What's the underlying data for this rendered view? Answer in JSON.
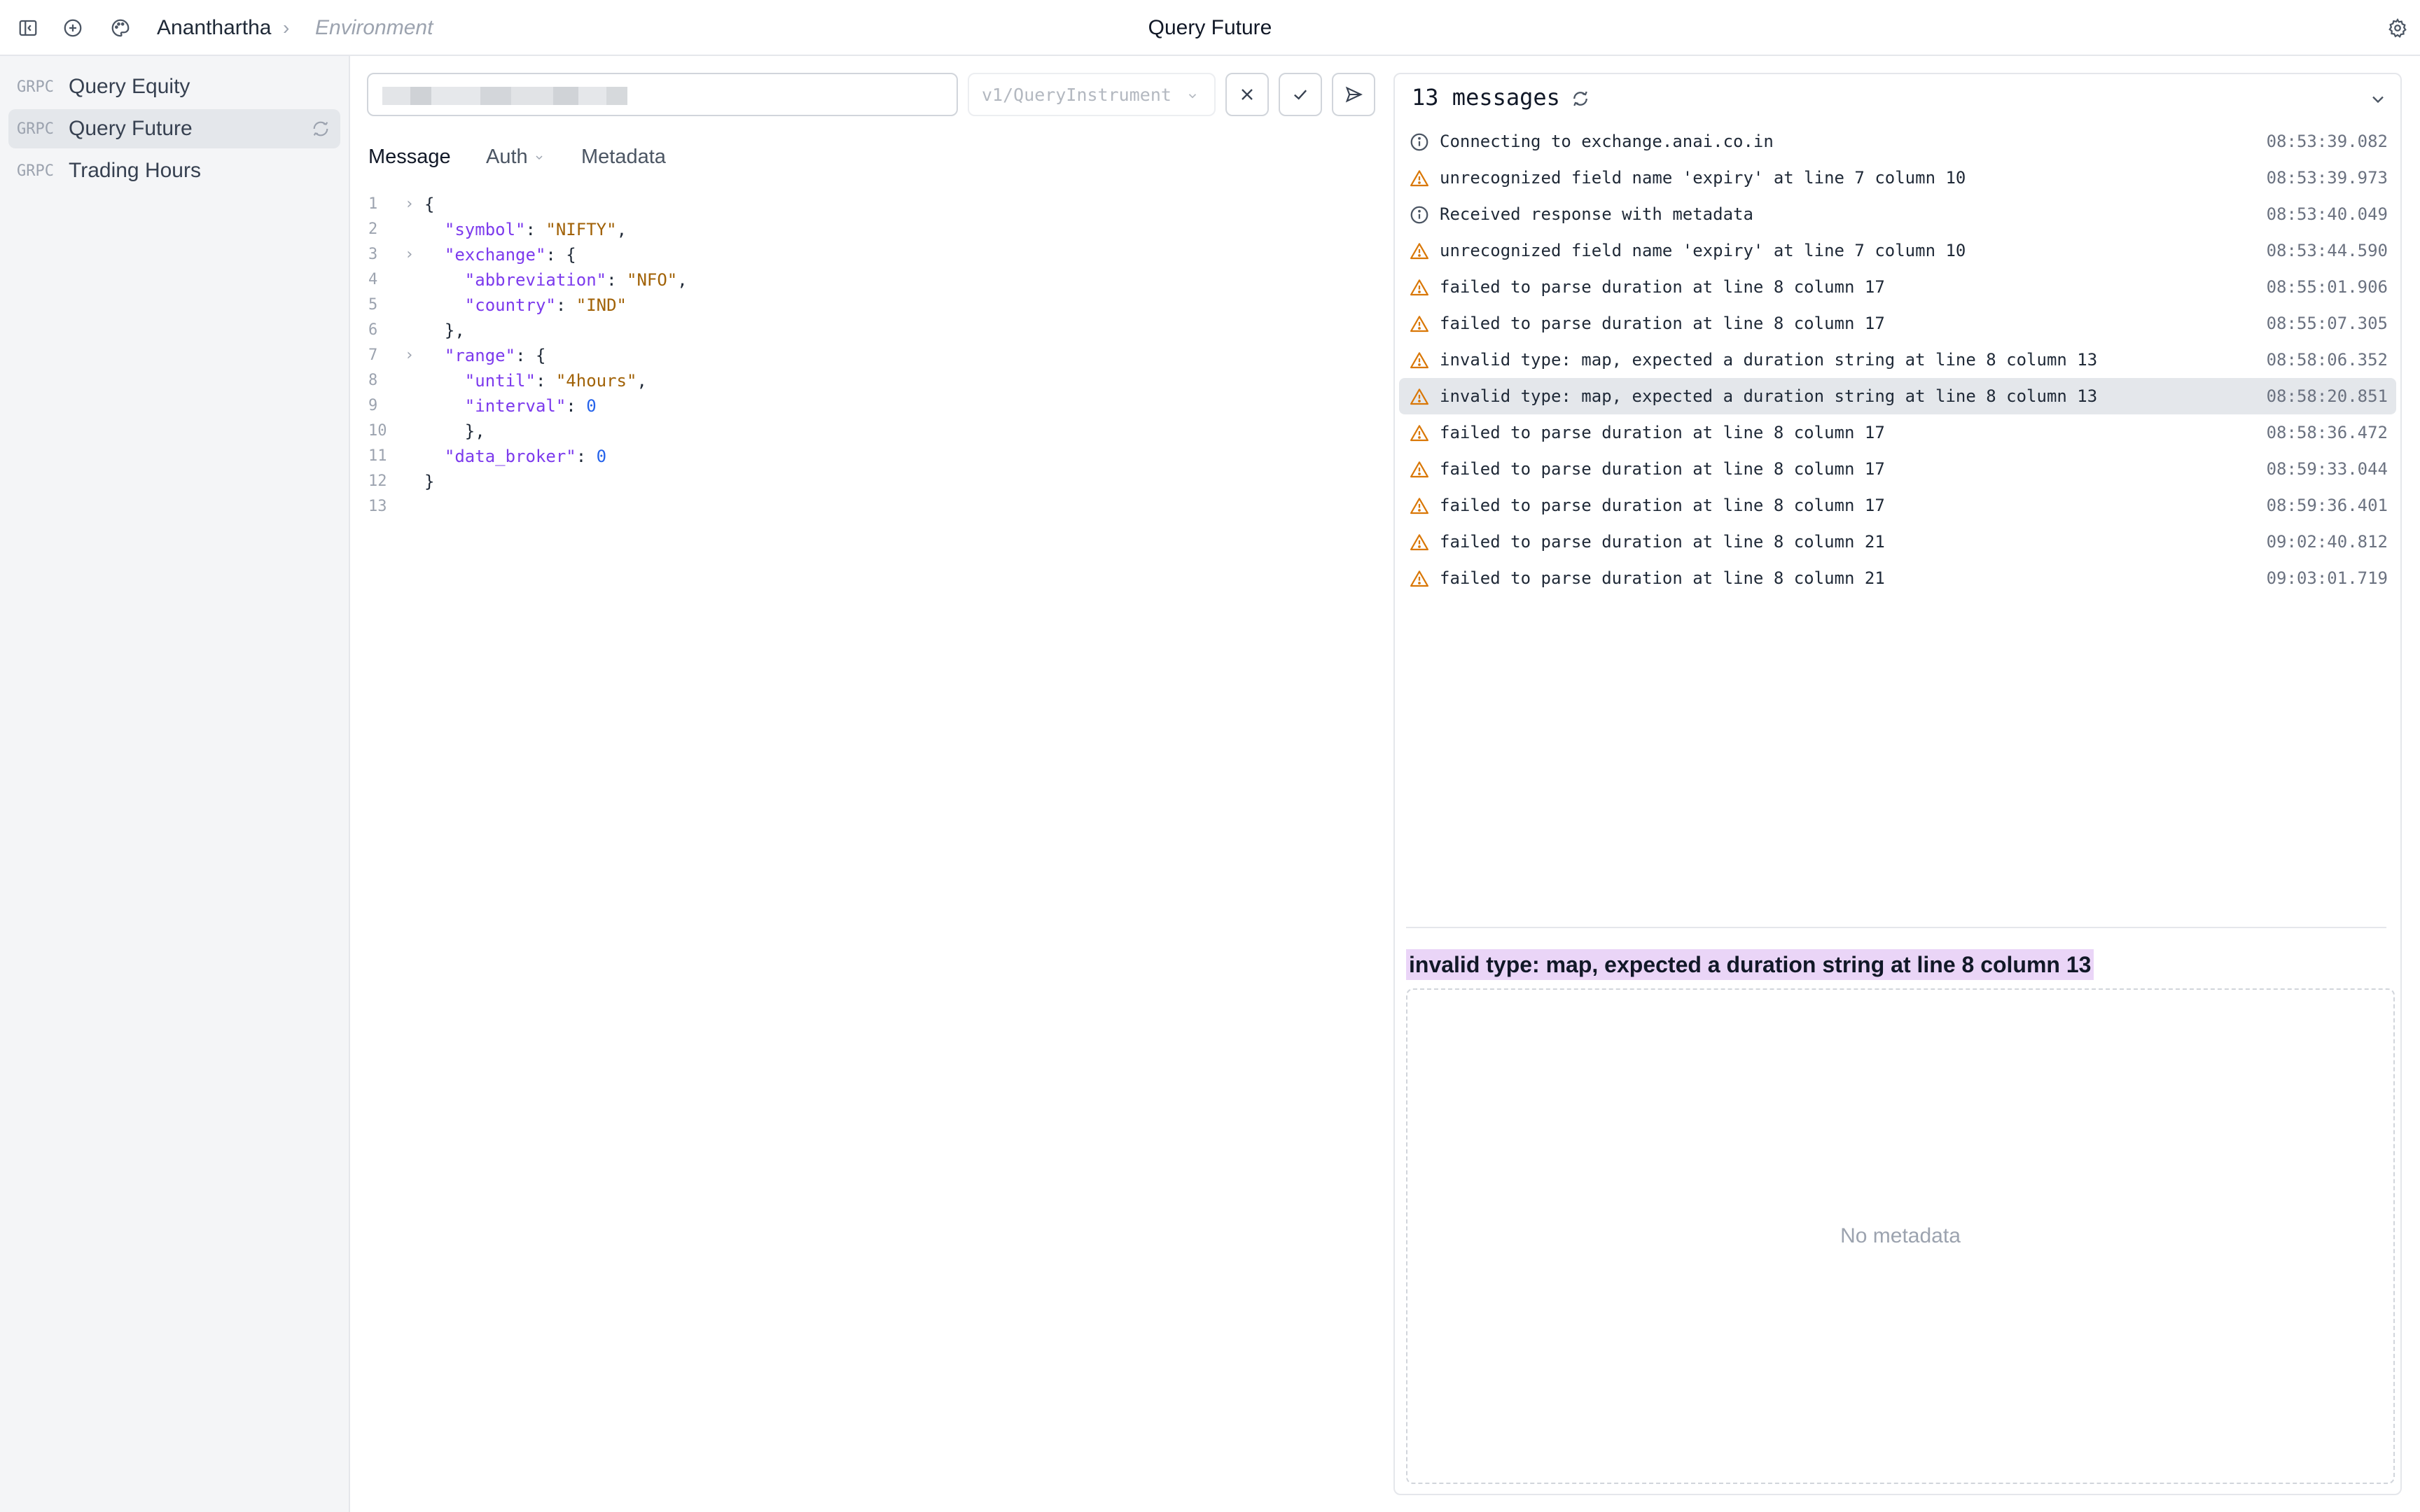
{
  "header": {
    "workspace": "Ananthartha",
    "separator": "›",
    "environment": "Environment",
    "title": "Query Future"
  },
  "sidebar": {
    "items": [
      {
        "tag": "GRPC",
        "label": "Query Equity"
      },
      {
        "tag": "GRPC",
        "label": "Query Future"
      },
      {
        "tag": "GRPC",
        "label": "Trading Hours"
      }
    ]
  },
  "request": {
    "method_placeholder": "v1/QueryInstrument",
    "tabs": [
      "Message",
      "Auth",
      "Metadata"
    ],
    "code": [
      {
        "n": "1",
        "fold": "›",
        "parts": [
          [
            "p",
            "{"
          ]
        ]
      },
      {
        "n": "2",
        "fold": "",
        "parts": [
          [
            "p",
            "  "
          ],
          [
            "k",
            "\"symbol\""
          ],
          [
            "p",
            ": "
          ],
          [
            "s",
            "\"NIFTY\""
          ],
          [
            "p",
            ","
          ]
        ]
      },
      {
        "n": "3",
        "fold": "›",
        "parts": [
          [
            "p",
            "  "
          ],
          [
            "k",
            "\"exchange\""
          ],
          [
            "p",
            ": {"
          ]
        ]
      },
      {
        "n": "4",
        "fold": "",
        "parts": [
          [
            "p",
            "    "
          ],
          [
            "k",
            "\"abbreviation\""
          ],
          [
            "p",
            ": "
          ],
          [
            "s",
            "\"NFO\""
          ],
          [
            "p",
            ","
          ]
        ]
      },
      {
        "n": "5",
        "fold": "",
        "parts": [
          [
            "p",
            "    "
          ],
          [
            "k",
            "\"country\""
          ],
          [
            "p",
            ": "
          ],
          [
            "s",
            "\"IND\""
          ]
        ]
      },
      {
        "n": "6",
        "fold": "",
        "parts": [
          [
            "p",
            "  },"
          ]
        ]
      },
      {
        "n": "7",
        "fold": "›",
        "parts": [
          [
            "p",
            "  "
          ],
          [
            "k",
            "\"range\""
          ],
          [
            "p",
            ": {"
          ]
        ]
      },
      {
        "n": "8",
        "fold": "",
        "parts": [
          [
            "p",
            "    "
          ],
          [
            "k",
            "\"until\""
          ],
          [
            "p",
            ": "
          ],
          [
            "s",
            "\"4hours\""
          ],
          [
            "p",
            ","
          ]
        ]
      },
      {
        "n": "9",
        "fold": "",
        "parts": [
          [
            "p",
            "    "
          ],
          [
            "k",
            "\"interval\""
          ],
          [
            "p",
            ": "
          ],
          [
            "n",
            "0"
          ]
        ]
      },
      {
        "n": "10",
        "fold": "",
        "parts": [
          [
            "p",
            "    },"
          ]
        ]
      },
      {
        "n": "11",
        "fold": "",
        "parts": [
          [
            "p",
            "  "
          ],
          [
            "k",
            "\"data_broker\""
          ],
          [
            "p",
            ": "
          ],
          [
            "n",
            "0"
          ]
        ]
      },
      {
        "n": "12",
        "fold": "",
        "parts": [
          [
            "p",
            "}"
          ]
        ]
      },
      {
        "n": "13",
        "fold": "",
        "parts": []
      }
    ]
  },
  "response": {
    "title": "13 messages",
    "messages": [
      {
        "type": "info",
        "text": "Connecting to exchange.anai.co.in",
        "time": "08:53:39.082"
      },
      {
        "type": "warning",
        "text": "unrecognized field name 'expiry' at line 7 column 10",
        "time": "08:53:39.973"
      },
      {
        "type": "info",
        "text": "Received response with metadata",
        "time": "08:53:40.049"
      },
      {
        "type": "warning",
        "text": "unrecognized field name 'expiry' at line 7 column 10",
        "time": "08:53:44.590"
      },
      {
        "type": "warning",
        "text": "failed to parse duration at line 8 column 17",
        "time": "08:55:01.906"
      },
      {
        "type": "warning",
        "text": "failed to parse duration at line 8 column 17",
        "time": "08:55:07.305"
      },
      {
        "type": "warning",
        "text": "invalid type: map, expected a duration string at line 8 column 13",
        "time": "08:58:06.352"
      },
      {
        "type": "warning",
        "text": "invalid type: map, expected a duration string at line 8 column 13",
        "time": "08:58:20.851",
        "selected": true
      },
      {
        "type": "warning",
        "text": "failed to parse duration at line 8 column 17",
        "time": "08:58:36.472"
      },
      {
        "type": "warning",
        "text": "failed to parse duration at line 8 column 17",
        "time": "08:59:33.044"
      },
      {
        "type": "warning",
        "text": "failed to parse duration at line 8 column 17",
        "time": "08:59:36.401"
      },
      {
        "type": "warning",
        "text": "failed to parse duration at line 8 column 21",
        "time": "09:02:40.812"
      },
      {
        "type": "warning",
        "text": "failed to parse duration at line 8 column 21",
        "time": "09:03:01.719"
      }
    ],
    "detail_title": "invalid type: map, expected a duration string at line 8 column 13",
    "metadata_empty": "No metadata"
  },
  "colors": {
    "warning": "#d97706",
    "info": "#4b5563",
    "key": "#7c3aed",
    "string": "#a16207",
    "number": "#2563eb",
    "selected_row": "#e4e7eb",
    "highlight": "#ead5f7"
  },
  "icons": {
    "sidebar_toggle": "sidebar-toggle-icon",
    "new": "plus-circle-icon",
    "theme": "palette-icon",
    "settings": "gear-icon",
    "cancel": "close-icon",
    "validate": "check-icon",
    "send": "send-icon",
    "refresh": "refresh-icon",
    "collapse": "chevron-down-icon",
    "info": "info-icon",
    "warning": "warning-icon"
  }
}
